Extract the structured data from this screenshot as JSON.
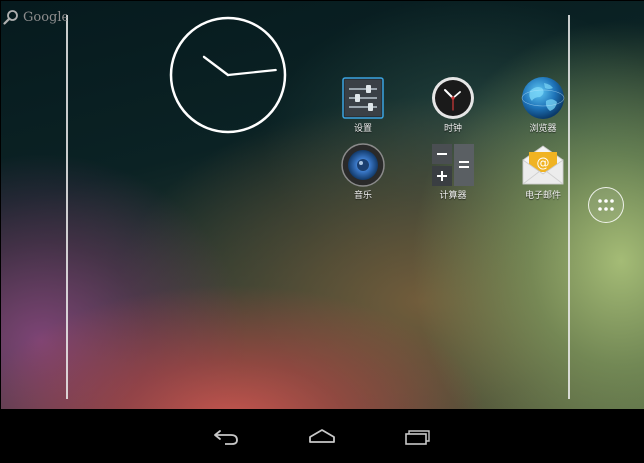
{
  "search": {
    "label": "Google",
    "icon": "search-icon"
  },
  "clock_widget": {
    "hour": 10,
    "minute": 14
  },
  "apps": [
    {
      "id": "settings",
      "label": "设置",
      "icon": "settings-icon"
    },
    {
      "id": "clock",
      "label": "时钟",
      "icon": "clock-icon"
    },
    {
      "id": "browser",
      "label": "浏览器",
      "icon": "globe-icon"
    },
    {
      "id": "music",
      "label": "音乐",
      "icon": "speaker-icon"
    },
    {
      "id": "calculator",
      "label": "计算器",
      "icon": "calculator-icon"
    },
    {
      "id": "email",
      "label": "电子邮件",
      "icon": "envelope-icon"
    }
  ],
  "all_apps": {
    "icon": "app-grid-icon"
  },
  "navbar": {
    "back_icon": "back-icon",
    "home_icon": "home-icon",
    "recent_icon": "recent-apps-icon"
  },
  "colors": {
    "navbar": "#000000",
    "label_text": "#f2f2f2",
    "settings_accent": "#2c7fb8",
    "email_accent": "#f0b322"
  }
}
